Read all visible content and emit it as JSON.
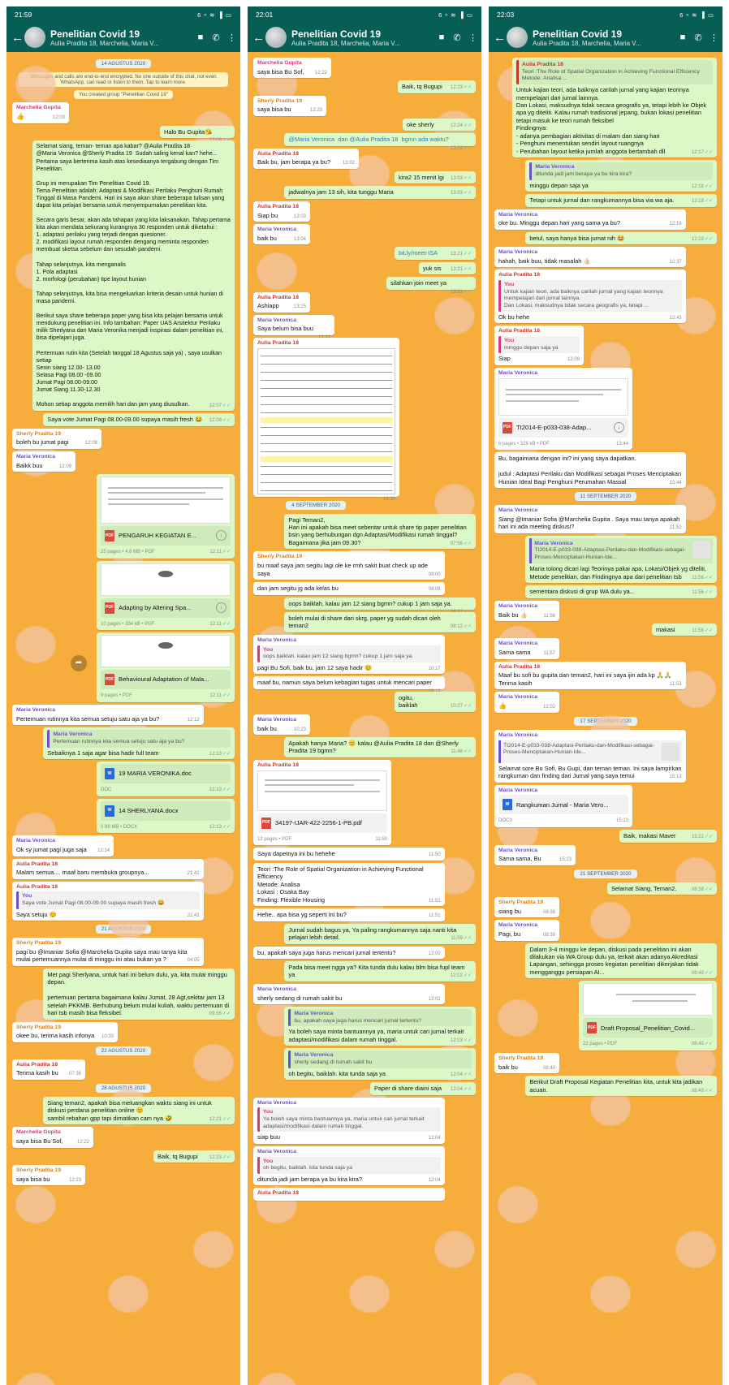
{
  "status": {
    "time_1": "21:59",
    "time_2": "22:01",
    "time_3": "22:03",
    "icons": "6 ⁿ ≋ ▐ ▭"
  },
  "group": {
    "title": "Penelitian Covid 19",
    "subtitle": "Aulia Pradita 18, Marchelia, Maria V..."
  },
  "panel1": {
    "date_1": "14 AGUSTUS 2020",
    "encryption": "Messages and calls are end-to-end encrypted. No one outside of this chat, not even WhatsApp, can read or listen to them. Tap to learn more.",
    "created": "You created group \"Penelitian Covid 19\"",
    "m1_sender": "Marchelia Gupita",
    "m1_text": "👍",
    "m1_time": "12:03",
    "m2_text": "Halo Bu Gupita😘",
    "m2_time": "12:06",
    "m3_text": "Selamat siang, teman- teman apa kabar? @Aulia Pradita 18 @Maria Veronica @Sherly Pradita 19  Sudah saling kenal kan? hehe...\nPertama saya berterima kasih atas kesediaanya tergabung dengan Tim Penelitian.\n\nGrup ini merupakan Tim Penelitian Covid 19.\nTema Penelitian adalah: Adaptasi & Modifikasi Perilaku Penghuni Rumah Tinggal di Masa Pandemi. Hari ini saya akan share beberapa tulisan yang dapat kita pelajari bersama untuk menyempurnakan penelitian kita.\n\nSecara garis besar, akan ada tahapan yang kita laksanakan. Tahap pertama kita akan mendata sekurang kurangnya 30 responden untuk diketahui :\n1. adaptasi perilaku yang terjadi dengan quesioner.\n2. modifikasi layout rumah responden dengang meminta responden membuat sketsa sebelum dan sesudah pandemi.\n\nTahap selanjutnya, kita menganalis\n1. Pola adaptasi\n2. morfologi (perubahan) tipe layout hunian\n\nTahap selanjutnya, kita bisa mengeluarkan kriteria desain untuk hunian di masa pandemi.\n\nBerikut saya share beberapa paper yang bisa kita pelajari bersama untuk mendukung penelitian ini. Info tambahan: Paper UAS Arsitektur Perilaku milik Sherlyana dan Maria Veronika menjadi inspirasi dalam penelitian ini, bisa dipelajari juga.\n\nPertemuan rutin kita (Setelah tanggal 18 Agustus saja ya) , saya usulkan setiap\nSenin siang 12.00- 13.00\nSelasa Pagi 08.00 -09.00\nJumat Pagi 08.00-09.00\nJumat Siang 11.30-12.30\n\nMohon setiap anggota memilih hari dan jam yang diusulkan.",
    "m3_time": "12:07",
    "m4_text": "Saya vote Jumat Pagi 08.00-09.00 supaya masih fresh 😂",
    "m4_time": "12:08",
    "m5_sender": "Sherly Pradita 19",
    "m5_text": "boleh bu jumat pagi",
    "m5_time": "12:08",
    "m6_sender": "Maria Veronica",
    "m6_text": "Baikk buu",
    "m6_time": "12:09",
    "doc1_name": "PENGARUH KEGIATAN E...",
    "doc1_meta": "25 pages • 4.8 MB • PDF",
    "doc1_time": "12:11",
    "doc2_name": "Adapting by Altering Spa...",
    "doc2_meta": "10 pages • 354 kB • PDF",
    "doc2_time": "12:11",
    "doc3_name": "Behavioural Adaptation of Mala...",
    "doc3_meta": "9 pages • PDF",
    "doc3_time": "12:11",
    "m7_sender": "Maria Veronica",
    "m7_text": "Pertemuan rutinnya kita semua setuju satu aja ya bu?",
    "m7_time": "12:12",
    "m8_quote_from": "Maria Veronica",
    "m8_quote": "Pertemuan rutinnya kita semua setuju satu aja ya bu?",
    "m8_text": "Sebaiknya 1 saja agar bisa hadir full team",
    "m8_time": "12:13",
    "doc4_name": "19 MARIA VERONIKA.doc",
    "doc4_meta": "DOC",
    "doc4_time": "12:13",
    "doc5_name": "14 SHERLYANA.docx",
    "doc5_meta": "0.99 MB • DOCX",
    "doc5_time": "12:13",
    "m9_sender": "Maria Veronica",
    "m9_text": "Ok sy jumat pagi juga saja",
    "m9_time": "12:14",
    "m10_sender": "Aulia Pradita 18",
    "m10_text": "Malam semua.... maaf baru membuka groupnya...",
    "m10_time": "21:41",
    "m11_sender": "Aulia Pradita 18",
    "m11_quote_from": "You",
    "m11_quote": "Saya vote Jumat Pagi 08.00-09.00 supaya masih fresh 😂",
    "m11_text": "Saya setuju 😊",
    "m11_time": "21:42",
    "date_2": "21 AGUSTUS 2020",
    "m12_sender": "Sherly Pradita 19",
    "m12_text": "pagi bu @Imaniar Sofia @Marchelia Gupita saya mau tanya kita mulai pertemuannya mulai di minggu ini atau bukan ya ?",
    "m12_time": "04:05",
    "m13_text": "Met pagi Sherlyana, untuk hari ini belum dulu, ya, kita mulai minggu depan.\n\npertemuan pertama bagaimana kalau Jumat, 28 Agt,sekitar jam 13 setelah PKKMB. Berhubung belum mulai kuliah, waktu pertemuan di hari tsb masih bisa fleksibel.",
    "m13_time": "09:56",
    "m14_sender": "Sherly Pradita 19",
    "m14_text": "okee bu, terima kasih infonya",
    "m14_time": "10:33",
    "date_3": "22 AGUSTUS 2020",
    "m15_sender": "Aulia Pradita 18",
    "m15_text": "Terima kasih bu",
    "m15_time": "07:36",
    "date_4": "28 AGUSTUS 2020",
    "m16_text": "Siang teman2, apakah bisa meluangkan waktu siang ini untuk diskusi perdana penelitian online 😊\nsambil rebahan gpp tapi dimatikan cam nya 🤣",
    "m16_time": "12:21",
    "m17_sender": "Marchelia Gupita",
    "m17_text": "saya bisa Bu Sof,",
    "m17_time": "12:22",
    "m18_text": "Baik, tq Bugupi",
    "m18_time": "12:23",
    "m19_sender": "Sherly Pradita 19",
    "m19_text": "saya bisa bu",
    "m19_time": "12:23"
  },
  "panel2": {
    "m1_sender": "Marchelia Gupita",
    "m1_text": "saya bisa Bu Sof,",
    "m1_time": "12:22",
    "m2_text": "Baik, tq Bugupi",
    "m2_time": "12:23",
    "m3_sender": "Sherly Pradita 19",
    "m3_text": "saya bisa bu",
    "m3_time": "12:23",
    "m4_text": "oke sherly",
    "m4_time": "12:24",
    "m5_text": "@Maria Veronica  dan @Aulia Pradita 18  bgmn ada waktu?",
    "m5_time": "13:02",
    "m6_sender": "Aulia Pradita 18",
    "m6_text": "Baik bu, jam berapa ya bu?",
    "m6_time": "13:02",
    "m7_text": "kira2 15 menit lgi",
    "m7_time": "13:03",
    "m8_text": "jadwalnya jam 13 sih, kita tunggu Maria",
    "m8_time": "13:03",
    "m9_sender": "Aulia Pradita 18",
    "m9_text": "Siap bu",
    "m9_time": "13:03",
    "m10_sender": "Maria Veronica",
    "m10_text": "baik bu",
    "m10_time": "13:04",
    "m11_text": "bit.ly/meet-ISA",
    "m11_time": "13:21",
    "m12_text": "yuk sis",
    "m12_time": "13:21",
    "m13_text": "silahkan join meet ya",
    "m13_time": "13:21",
    "m14_sender": "Aulia Pradita 18",
    "m14_text": "Ashiapp",
    "m14_time": "13:25",
    "m15_sender": "Maria Veronica",
    "m15_text": "Saya belum bisa buu",
    "m15_time": "13:33",
    "m16_sender": "Aulia Pradita 18",
    "m16_time": "14:30",
    "date_1": "4 SEPTEMBER 2020",
    "m17_text": "Pagi Teman2,\nHari ini apakah bisa meet sebentar untuk share tip paper penelitian bsin yang berhubungan dgn Adaptasi/Modifikasi rumah tinggal?\nBagaimana jika jam 09.30?",
    "m17_time": "07:56",
    "m18_sender": "Sherly Pradita 19",
    "m18_text": "bu maaf saya jam segitu lagi ole ke rmh sakit buat check up ade saya",
    "m18_time": "08:00",
    "m19_text": "dan jam segitu jg ada kelas bu",
    "m19_time": "08:08",
    "m20_text": "oops baiklah, kalau jam 12 siang bgmn? cukup 1 jam saja ya.",
    "m20_time": "08:11",
    "m21_text": "boleh mulai di share dari skrg, paper yg sudah dicari oleh teman2",
    "m21_time": "08:12",
    "m22_sender": "Maria Veronica",
    "m22_quote_from": "You",
    "m22_quote": "oops baiklah. kalau jam 12 siang bgmn? cukup 1 jam saja ya.",
    "m22_text": "pagi Bu Sofi, baik bu, jam 12 saya hadir 😊",
    "m22_time": "10:17",
    "m23_text": "maaf bu, namun saya belum kebagian tugas untuk mencari paper",
    "m23_time": "10:18",
    "m24_text": "ogitu, baiklah",
    "m24_time": "10:27",
    "m25_sender": "Maria Veronica",
    "m25_text": "baik bu",
    "m25_time": "10:23",
    "m26_text": "Apakah hanya Maria? 😊 kalau @Aulia Pradita 18 dan @Sherly Pradita 19 bgmn?",
    "m26_time": "11:48",
    "m27_sender": "Aulia Pradita 18",
    "doc1_name": "34197-IJAR-422-2256-1-PB.pdf",
    "doc1_meta": "12 pages • PDF",
    "doc1_time": "11:50",
    "m28_text": "Saya dapetnya ini bu hehehe",
    "m28_time": "11:50",
    "m29_text": "Teori :The Role of Spatial Organization in Achieving Functional Efficiency\nMetode: Analisa\nLokasi : Osaka Bay\nFinding: Flexible Housing",
    "m29_time": "11:51",
    "m30_text": "Hehe.. apa bisa yg seperti ini bu?",
    "m30_time": "11:51",
    "m31_text": "Jurnal sudah bagus ya, Ya paling rangkumannya saja nanti kita pelajari lebih detail.",
    "m31_time": "11:59",
    "m32_text": "bu, apakah saya juga harus mencari jurnal tertentu?",
    "m32_time": "12:00",
    "m33_text": "Pada bisa meet ngga ya? Kita tunda dulu kalau blm bisa fupl team ya",
    "m33_time": "12:02",
    "m34_sender": "Maria Veronica",
    "m34_text": "sherly sedang di rumah sakit bu",
    "m34_time": "12:02",
    "m35_quote_from": "Maria Veronica",
    "m35_quote": "bu, apakah saya juga harus mencari jurnal tertentu?",
    "m35_text": "Ya boleh saya minta bantuannya ya, maria untuk cari jurnal terkait adaptasi/modifikasi dalam rumah tinggal.",
    "m35_time": "12:03",
    "m36_quote_from": "Maria Veronica",
    "m36_quote": "sherly sedang di rumah sakit bu",
    "m36_text": "oh begitu, baiklah. kita tunda saja ya",
    "m36_time": "12:04",
    "m37_text": "Paper di share diaini saja",
    "m37_time": "12:04",
    "m38_sender": "Maria Veronica",
    "m38_quote_from": "You",
    "m38_quote": "Ya boleh saya minta bantuannya ya, maria untuk cari jurnal terkait adaptasi/modifikasi dalam rumah tinggal.",
    "m38_text": "siap buu",
    "m38_time": "12:04",
    "m39_sender": "Maria Veronica",
    "m39_quote_from": "You",
    "m39_quote": "oh begitu, baiklah. kita tunda saja ya",
    "m39_text": "ditunda jadi jam berapa ya bu kira kira?",
    "m39_time": "12:04",
    "m40_sender": "Aulia Pradita 18"
  },
  "panel3": {
    "m1_top_sender": "Aulia Pradita 18",
    "m1_top_quote": "Teori :The Role of Spatial Organization in Achieving Functional Efficiency\nMetode: Analisa ...",
    "m1_text": "Untuk kajian teori, ada baiknya carilah jurnal yang kajian teorinya mempelajari dari jurnal lainnya.\nDan Lokasi, maksudnya tidak secara geografis ya, tetapi lebih ke Objek apa yg diteliti. Kalau rumah tradisional jepang, bukan lokasi penelitian tetapi masuk ke teori rumah fleksibel\nFindingnya:\n- adanya pembagian aktivitas di malam dan siang hari\n- Penghuni menentukan sendiri layout ruangnya\n- Perubahan layout ketika jumlah anggota bertambah dll",
    "m1_time": "12:17",
    "m2_quote_from": "Maria Veronica",
    "m2_quote": "ditunda jadi jam berapa ya bu kira kira?",
    "m2_text": "minggu depan saja ya",
    "m2_time": "12:18",
    "m3_text": "Tetapi untuk jurnal dan rangkumannya bisa via wa aja.",
    "m3_time": "12:18",
    "m4_sender": "Maria Veronica",
    "m4_text": "oke bu. Minggu depan hari yang sama ya bu?",
    "m4_time": "12:19",
    "m5_text": "betul, saya hanya bisa jumat nih 😂",
    "m5_time": "12:20",
    "m6_sender": "Maria Veronica",
    "m6_text": "hahah, baik buu, tidak masalah 👍🏻",
    "m6_time": "12:37",
    "m7_sender": "Aulia Pradita 18",
    "m7_quote_from": "You",
    "m7_quote": "Untuk kajian teori, ada baiknya carilah jurnal yang kajian teorinya mempelajari dari jurnal lainnya.\nDan Lokasi, maksudnya tidak secara geografis ya, tetapi ...",
    "m7_text": "Ok bu hehe",
    "m7_time": "12:43",
    "m8_sender": "Aulia Pradita 18",
    "m8_quote_from": "You",
    "m8_quote": "minggu depan saja ya",
    "m8_text": "Siap",
    "m8_time": "12:09",
    "m9_sender": "Maria Veronica",
    "doc1_name": "TI2014-E-p033-038-Adap...",
    "doc1_meta": "6 pages • 326 kB • PDF",
    "doc1_time": "13:44",
    "m10_text": "Bu, bagaimana dengan ini? ini yang saya dapatkan.\n\njudul : Adaptasi Perilaku dan Modifikasi sebagai Proses Menciptakan Hunian Ideal Bagi Penghuni Perumahan Massal",
    "m10_time": "13:44",
    "date_1": "11 SEPTEMBER 2020",
    "m11_sender": "Maria Veronica",
    "m11_text": "Siang @Imaniar Sofia @Marchelia Gupita . Saya mau tanya apakah hari ini ada meeting diskusi?",
    "m11_time": "11:52",
    "m12_quote_from": "Maria Veronica",
    "m12_quote": "TI2014-E-p033-038-Adaptasi-Perilaku-dan-Modifikasi-sebagai-Proses-Menciptakan-Hunian-Ide...",
    "m12_text": "Maria tolong dicari lagi Teorinya pakai apa, Lokasi/Objek yg diteliti, Metode penelitian, dan Findingnya apa dari penelitian tsb",
    "m12_time": "11:56",
    "m13_text": "sementara diskusi di grup WA dulu ya...",
    "m13_time": "11:56",
    "m14_sender": "Maria Veronica",
    "m14_text": "Baik bu 👍🏻",
    "m14_time": "11:56",
    "m15_text": "makasi",
    "m15_time": "11:56",
    "m16_sender": "Maria Veronica",
    "m16_text": "Sama sama",
    "m16_time": "11:57",
    "m17_sender": "Aulia Pradita 18",
    "m17_text": "Maaf bu sofi bu gupita dan teman2, hari ini saya ijin ada kp 🙏🙏\nTerima kasih",
    "m17_time": "11:53",
    "m18_sender": "Maria Veronica",
    "m18_text": "👍",
    "m18_time": "12:02",
    "date_2": "17 SEPTEMBER 2020",
    "m19_sender": "Maria Veronica",
    "m19_link": "TI2014-E-p033-038-Adaptasi-Perilaku-dan-Modifikasi-sebagai-Proses-Menciptakan-Hunian-Ide...",
    "m19_text": "Selamat sore Bu Sofi, Bu Gupi, dan teman teman. Ini saya lampirkan rangkuman dan finding dari Jurnal yang saya temui",
    "m19_time": "15:13",
    "m20_sender": "Maria Veronica",
    "doc2_name": "Rangkuman Jurnal - Maria Vero...",
    "doc2_meta": "DOCX",
    "doc2_time": "15:13",
    "m21_text": "Baik, makasi Maver",
    "m21_time": "15:21",
    "m22_sender": "Maria Veronica",
    "m22_text": "Sama sama, Bu",
    "m22_time": "15:23",
    "date_3": "21 SEPTEMBER 2020",
    "m23_text": "Selamat Siang, Teman2.",
    "m23_time": "08:38",
    "m24_sender": "Sherly Pradita 19",
    "m24_text": "siang bu",
    "m24_time": "08:38",
    "m25_sender": "Maria Veronica",
    "m25_text": "Pagi, bu",
    "m25_time": "08:39",
    "m26_text": "Dalam 3-4 minggu ke depan, diskusi pada penelitian ini akan dilakukan via WA Group dulu ya, terkait akan adanya Akreditasi Lapangan, sehingga proses kegiatan penelitian dikerjakan tidak mengganggu persiapan AI...",
    "m26_time": "08:40",
    "doc3_name": "Draft Proposal_Penelitian_Covid...",
    "doc3_meta": "22 pages • PDF",
    "doc3_time": "08:40",
    "m27_sender": "Sherly Pradita 19",
    "m27_text": "baik bu",
    "m27_time": "08:40",
    "m28_text": "Berikut Draft Proposal Kegiatan Penelitian kita, untuk kita jadikan acuan.",
    "m28_time": "08:40"
  }
}
